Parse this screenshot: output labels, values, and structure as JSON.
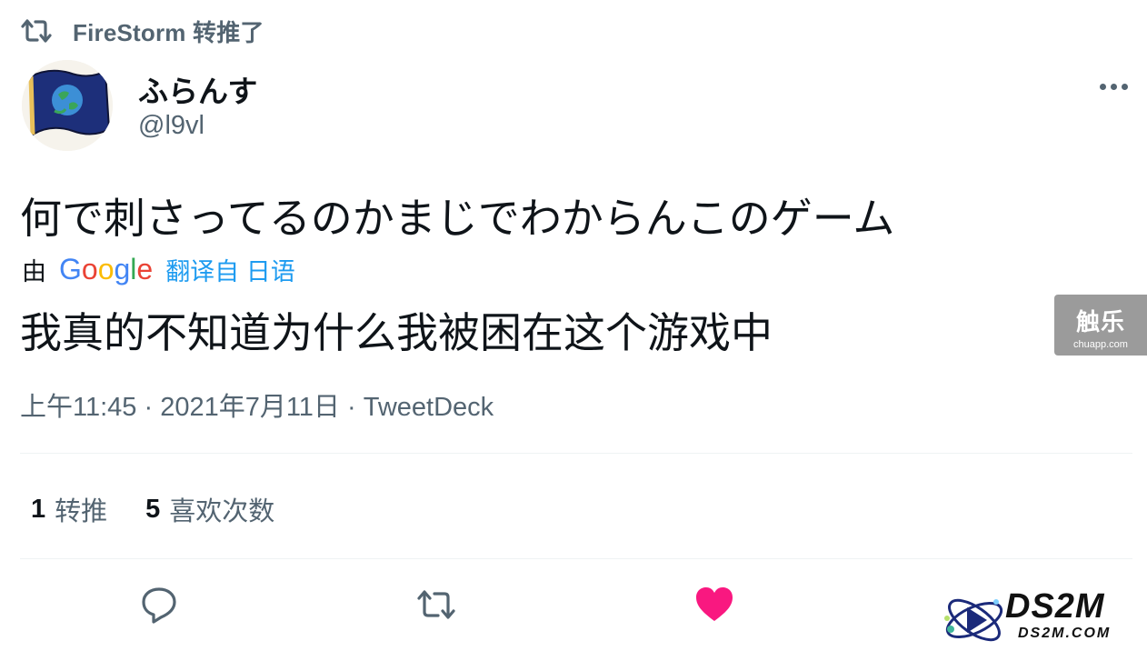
{
  "retweet_header": {
    "icon": "retweet-icon",
    "text": "FireStorm 转推了"
  },
  "author": {
    "avatar_icon": "flag-globe-avatar",
    "display_name": "ふらんす",
    "handle": "@l9vl"
  },
  "more_icon": "more-horizontal-icon",
  "tweet": {
    "text": "何で刺さってるのかまじでわからんこのゲーム",
    "translation": {
      "by_label": "由",
      "provider": "Google",
      "link_text": "翻译自 日语",
      "text": "我真的不知道为什么我被困在这个游戏中"
    },
    "timestamp": "上午11:45 · 2021年7月11日",
    "separator": " · ",
    "source": "TweetDeck"
  },
  "stats": {
    "retweets": {
      "count": "1",
      "label": "转推"
    },
    "likes": {
      "count": "5",
      "label": "喜欢次数"
    }
  },
  "actions": [
    {
      "name": "reply",
      "icon": "reply-icon"
    },
    {
      "name": "retweet",
      "icon": "retweet-icon"
    },
    {
      "name": "like",
      "icon": "heart-filled-icon",
      "color": "#f91880"
    }
  ],
  "colors": {
    "secondary_text": "#536471",
    "link": "#1d9bf0",
    "like": "#f91880",
    "divider": "#eff3f4"
  },
  "watermarks": {
    "chuapp": {
      "main": "触乐",
      "sub": "chuapp.com"
    },
    "ds2m": {
      "main": "DS2M",
      "sub": "DS2M.COM"
    }
  }
}
